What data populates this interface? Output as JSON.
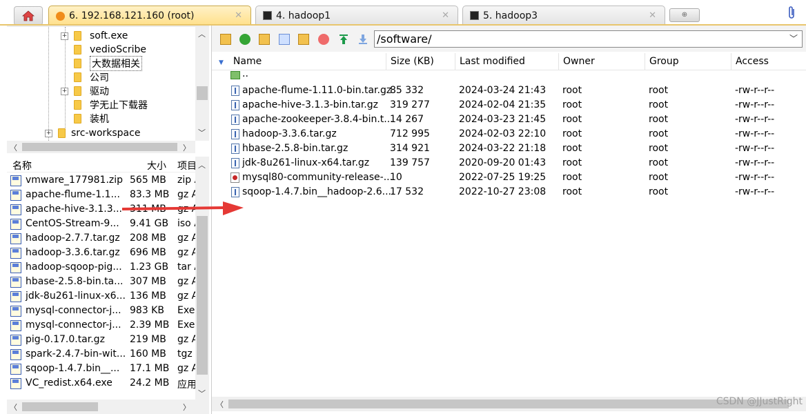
{
  "tabs": [
    {
      "label": "6. 192.168.121.160 (root)",
      "active": true
    },
    {
      "label": "4. hadoop1",
      "active": false
    },
    {
      "label": "5. hadoop3",
      "active": false
    }
  ],
  "tab_close": "✕",
  "tree": {
    "items": [
      {
        "label": "soft.exe"
      },
      {
        "label": "vedioScribe"
      },
      {
        "label": "大数据相关"
      },
      {
        "label": "公司"
      },
      {
        "label": "驱动"
      },
      {
        "label": "学无止下载器"
      },
      {
        "label": "装机"
      },
      {
        "label": "src-workspace"
      }
    ]
  },
  "local": {
    "headers": {
      "name": "名称",
      "size": "大小",
      "type": "项目"
    },
    "rows": [
      {
        "name": "vmware_177981.zip",
        "size": "565 MB",
        "type": "zip A"
      },
      {
        "name": "apache-flume-1.1...",
        "size": "83.3 MB",
        "type": "gz A"
      },
      {
        "name": "apache-hive-3.1.3...",
        "size": "311 MB",
        "type": "gz A"
      },
      {
        "name": "CentOS-Stream-9...",
        "size": "9.41 GB",
        "type": "iso A"
      },
      {
        "name": "hadoop-2.7.7.tar.gz",
        "size": "208 MB",
        "type": "gz A"
      },
      {
        "name": "hadoop-3.3.6.tar.gz",
        "size": "696 MB",
        "type": "gz A"
      },
      {
        "name": "hadoop-sqoop-pig...",
        "size": "1.23 GB",
        "type": "tar A"
      },
      {
        "name": "hbase-2.5.8-bin.ta...",
        "size": "307 MB",
        "type": "gz A"
      },
      {
        "name": "jdk-8u261-linux-x6...",
        "size": "136 MB",
        "type": "gz A"
      },
      {
        "name": "mysql-connector-j...",
        "size": "983 KB",
        "type": "Exe"
      },
      {
        "name": "mysql-connector-j...",
        "size": "2.39 MB",
        "type": "Exe"
      },
      {
        "name": "pig-0.17.0.tar.gz",
        "size": "219 MB",
        "type": "gz A"
      },
      {
        "name": "spark-2.4.7-bin-wit...",
        "size": "160 MB",
        "type": "tgz A"
      },
      {
        "name": "sqoop-1.4.7.bin__...",
        "size": "17.1 MB",
        "type": "gz A"
      },
      {
        "name": "VC_redist.x64.exe",
        "size": "24.2 MB",
        "type": "应用"
      }
    ]
  },
  "remote": {
    "path": "/software/",
    "headers": {
      "name": "Name",
      "size": "Size (KB)",
      "modified": "Last modified",
      "owner": "Owner",
      "group": "Group",
      "access": "Access"
    },
    "parent": "..",
    "rows": [
      {
        "name": "apache-flume-1.11.0-bin.tar.gz",
        "size": "85 332",
        "modified": "2024-03-24 21:43",
        "owner": "root",
        "group": "root",
        "access": "-rw-r--r--"
      },
      {
        "name": "apache-hive-3.1.3-bin.tar.gz",
        "size": "319 277",
        "modified": "2024-02-04 21:35",
        "owner": "root",
        "group": "root",
        "access": "-rw-r--r--"
      },
      {
        "name": "apache-zookeeper-3.8.4-bin.t...",
        "size": "14 267",
        "modified": "2024-03-23 21:45",
        "owner": "root",
        "group": "root",
        "access": "-rw-r--r--"
      },
      {
        "name": "hadoop-3.3.6.tar.gz",
        "size": "712 995",
        "modified": "2024-02-03 22:10",
        "owner": "root",
        "group": "root",
        "access": "-rw-r--r--"
      },
      {
        "name": "hbase-2.5.8-bin.tar.gz",
        "size": "314 921",
        "modified": "2024-03-22 21:18",
        "owner": "root",
        "group": "root",
        "access": "-rw-r--r--"
      },
      {
        "name": "jdk-8u261-linux-x64.tar.gz",
        "size": "139 757",
        "modified": "2020-09-20 01:43",
        "owner": "root",
        "group": "root",
        "access": "-rw-r--r--"
      },
      {
        "name": "mysql80-community-release-...",
        "size": "10",
        "modified": "2022-07-25 19:25",
        "owner": "root",
        "group": "root",
        "access": "-rw-r--r--"
      },
      {
        "name": "sqoop-1.4.7.bin__hadoop-2.6....",
        "size": "17 532",
        "modified": "2022-10-27 23:08",
        "owner": "root",
        "group": "root",
        "access": "-rw-r--r--"
      }
    ]
  },
  "watermark": "CSDN @JJustRight",
  "colors": {
    "accent": "#e8c56c",
    "arrow": "#e53935"
  }
}
